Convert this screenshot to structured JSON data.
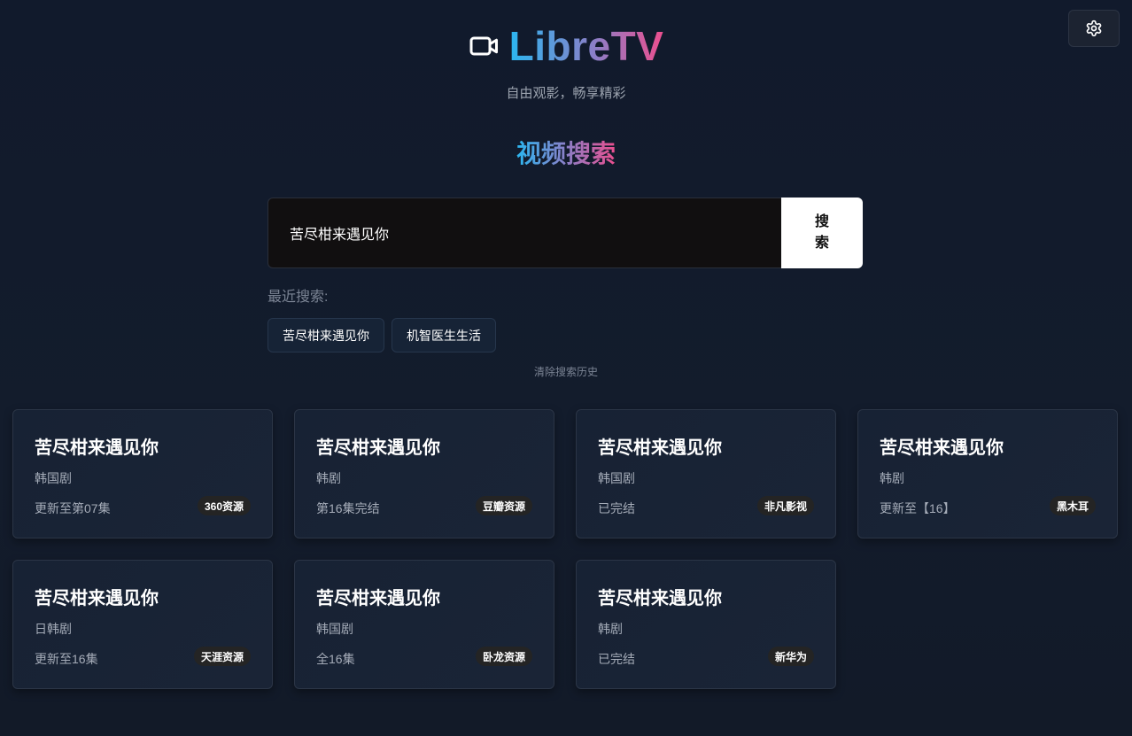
{
  "app": {
    "title": "LibreTV",
    "tagline": "自由观影，畅享精彩"
  },
  "icons": {
    "logo": "video-camera-icon",
    "settings": "gear-icon"
  },
  "colors": {
    "gradient_start": "#2bb6f0",
    "gradient_mid": "#8b7fc8",
    "gradient_end": "#ec4f8f",
    "background": "#121a2a",
    "card_bg": "#172234"
  },
  "search": {
    "heading": "视频搜索",
    "value": "苦尽柑来遇见你",
    "button_char_1": "搜",
    "button_char_2": "索"
  },
  "recent": {
    "label": "最近搜索:",
    "tags": [
      "苦尽柑来遇见你",
      "机智医生生活"
    ],
    "clear_label": "清除搜索历史"
  },
  "results": [
    {
      "title": "苦尽柑来遇见你",
      "type": "韩国剧",
      "remark": "更新至第07集",
      "source": "360资源"
    },
    {
      "title": "苦尽柑来遇见你",
      "type": "韩剧",
      "remark": "第16集完结",
      "source": "豆瓣资源"
    },
    {
      "title": "苦尽柑来遇见你",
      "type": "韩国剧",
      "remark": "已完结",
      "source": "非凡影视"
    },
    {
      "title": "苦尽柑来遇见你",
      "type": "韩剧",
      "remark": "更新至【16】",
      "source": "黑木耳"
    },
    {
      "title": "苦尽柑来遇见你",
      "type": "日韩剧",
      "remark": "更新至16集",
      "source": "天涯资源"
    },
    {
      "title": "苦尽柑来遇见你",
      "type": "韩国剧",
      "remark": "全16集",
      "source": "卧龙资源"
    },
    {
      "title": "苦尽柑来遇见你",
      "type": "韩剧",
      "remark": "已完结",
      "source": "新华为"
    }
  ]
}
